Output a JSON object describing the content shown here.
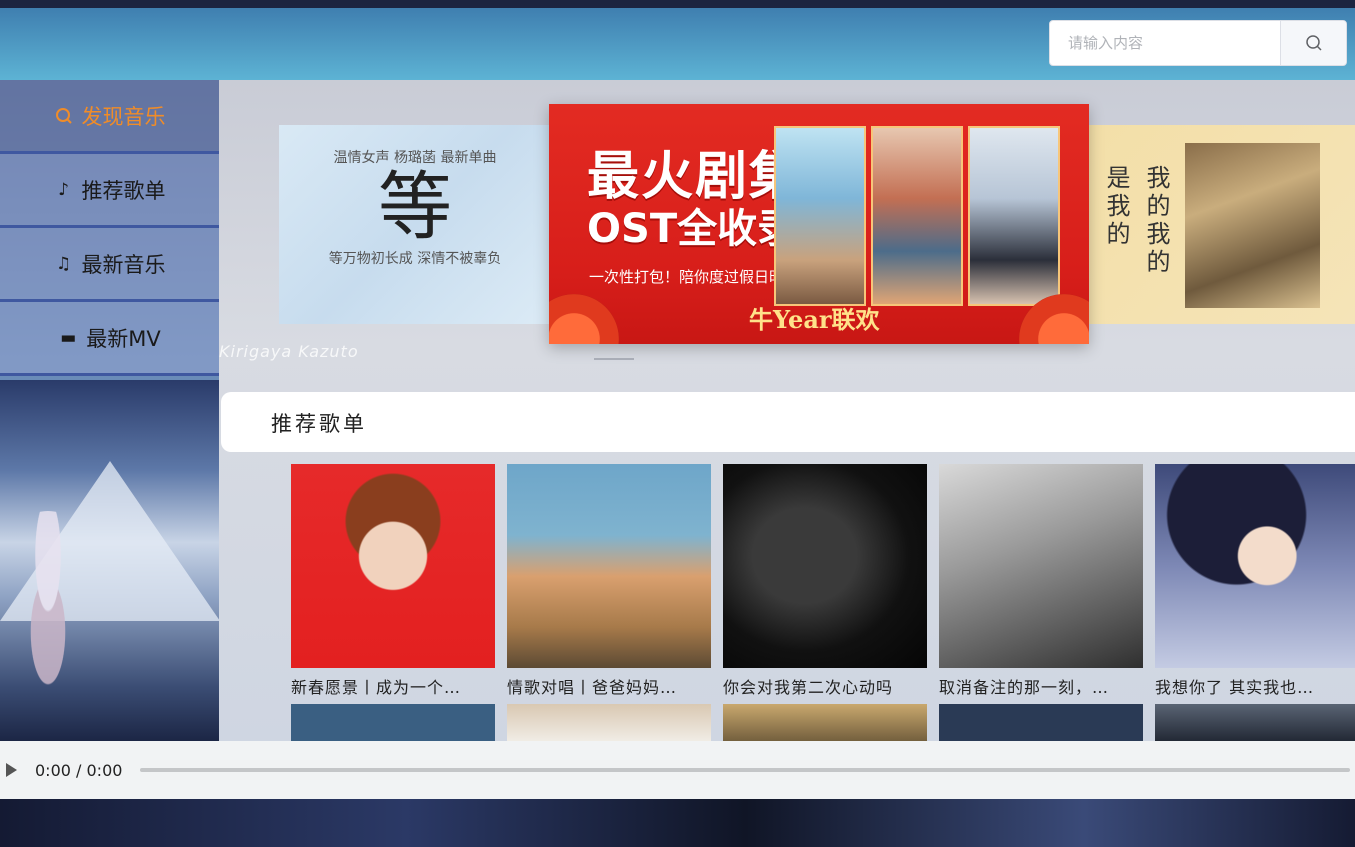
{
  "search": {
    "placeholder": "请输入内容"
  },
  "sidebar": {
    "items": [
      {
        "label": "发现音乐",
        "icon": "search-icon"
      },
      {
        "label": "推荐歌单",
        "icon": "guitar-icon"
      },
      {
        "label": "最新音乐",
        "icon": "music-note-icon"
      },
      {
        "label": "最新MV",
        "icon": "video-icon"
      }
    ]
  },
  "banners": {
    "left": {
      "top": "温情女声 杨璐菡 最新单曲",
      "logo": "等",
      "bottom": "等万物初长成 深情不被辜负"
    },
    "center": {
      "title": "最火剧集",
      "subtitle": "OST全收录",
      "tagline": "一次性打包！陪你度过假日时光",
      "bottom": "牛Year联欢"
    },
    "right": {
      "line1": "是我的",
      "line2": "我的我的"
    }
  },
  "watermark": "Kirigaya Kazuto",
  "section": {
    "title": "推荐歌单"
  },
  "playlists": [
    {
      "caption": "新春愿景丨成为一个…"
    },
    {
      "caption": "情歌对唱丨爸爸妈妈…"
    },
    {
      "caption": "你会对我第二次心动吗"
    },
    {
      "caption": "取消备注的那一刻，…"
    },
    {
      "caption": "我想你了 其实我也…"
    }
  ],
  "player": {
    "time": "0:00 / 0:00"
  }
}
